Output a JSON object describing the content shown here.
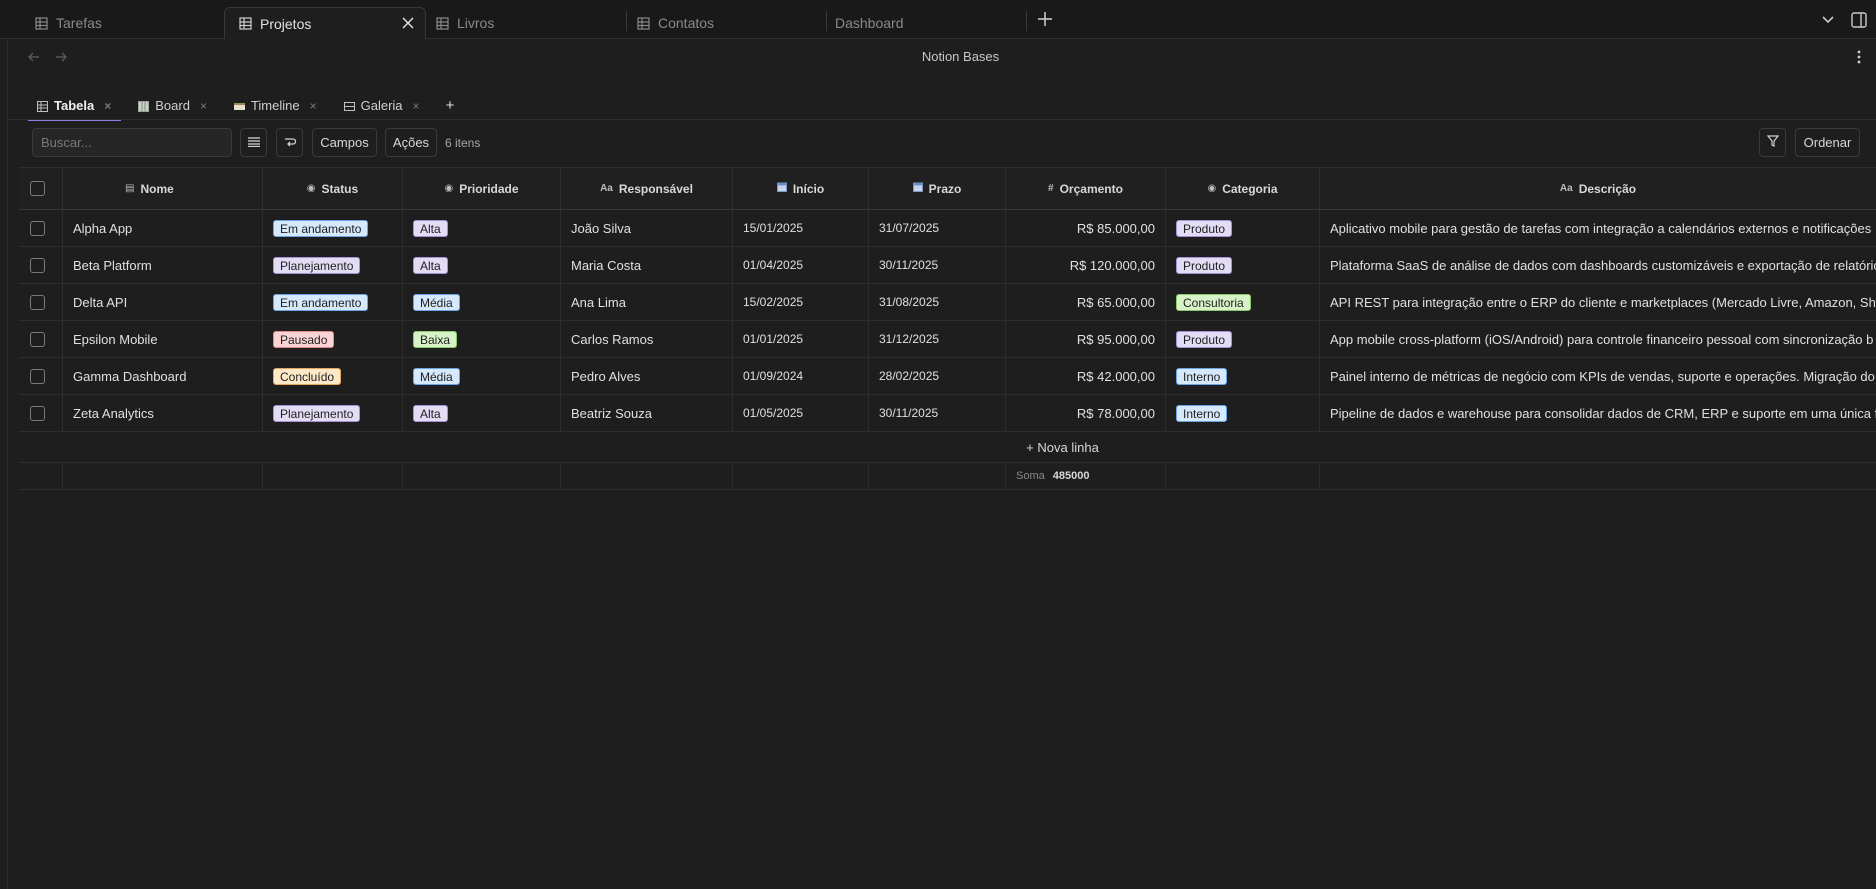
{
  "window_tabs": [
    {
      "label": "Tarefas",
      "active": false
    },
    {
      "label": "Projetos",
      "active": true
    },
    {
      "label": "Livros",
      "active": false
    },
    {
      "label": "Contatos",
      "active": false
    },
    {
      "label": "Dashboard",
      "active": false
    }
  ],
  "app_title": "Notion Bases",
  "view_tabs": [
    {
      "label": "Tabela",
      "icon": "table-icon",
      "active": true
    },
    {
      "label": "Board",
      "icon": "board-icon",
      "active": false
    },
    {
      "label": "Timeline",
      "icon": "timeline-icon",
      "active": false
    },
    {
      "label": "Galeria",
      "icon": "gallery-icon",
      "active": false
    }
  ],
  "toolbar": {
    "search_placeholder": "Buscar...",
    "fields_label": "Campos",
    "actions_label": "Ações",
    "count_label": "6 itens",
    "sort_label": "Ordenar"
  },
  "columns": [
    {
      "key": "nome",
      "label": "Nome",
      "icon": "page-icon"
    },
    {
      "key": "status",
      "label": "Status",
      "icon": "select-icon"
    },
    {
      "key": "prioridade",
      "label": "Prioridade",
      "icon": "select-icon"
    },
    {
      "key": "responsavel",
      "label": "Responsável",
      "icon": "text-icon"
    },
    {
      "key": "inicio",
      "label": "Início",
      "icon": "calendar-icon"
    },
    {
      "key": "prazo",
      "label": "Prazo",
      "icon": "calendar-icon"
    },
    {
      "key": "orcamento",
      "label": "Orçamento",
      "icon": "number-icon"
    },
    {
      "key": "categoria",
      "label": "Categoria",
      "icon": "select-icon"
    },
    {
      "key": "descricao",
      "label": "Descrição",
      "icon": "text-icon"
    }
  ],
  "rows": [
    {
      "nome": "Alpha App",
      "status": "Em andamento",
      "prioridade": "Alta",
      "responsavel": "João Silva",
      "inicio": "15/01/2025",
      "prazo": "31/07/2025",
      "orcamento": "R$ 85.000,00",
      "categoria": "Produto",
      "descricao": "Aplicativo mobile para gestão de tarefas com integração a calendários externos e notificações"
    },
    {
      "nome": "Beta Platform",
      "status": "Planejamento",
      "prioridade": "Alta",
      "responsavel": "Maria Costa",
      "inicio": "01/04/2025",
      "prazo": "30/11/2025",
      "orcamento": "R$ 120.000,00",
      "categoria": "Produto",
      "descricao": "Plataforma SaaS de análise de dados com dashboards customizáveis e exportação de relatórios"
    },
    {
      "nome": "Delta API",
      "status": "Em andamento",
      "prioridade": "Média",
      "responsavel": "Ana Lima",
      "inicio": "15/02/2025",
      "prazo": "31/08/2025",
      "orcamento": "R$ 65.000,00",
      "categoria": "Consultoria",
      "descricao": "API REST para integração entre o ERP do cliente e marketplaces (Mercado Livre, Amazon, Shop"
    },
    {
      "nome": "Epsilon Mobile",
      "status": "Pausado",
      "prioridade": "Baixa",
      "responsavel": "Carlos Ramos",
      "inicio": "01/01/2025",
      "prazo": "31/12/2025",
      "orcamento": "R$ 95.000,00",
      "categoria": "Produto",
      "descricao": "App mobile cross-platform (iOS/Android) para controle financeiro pessoal com sincronização b"
    },
    {
      "nome": "Gamma Dashboard",
      "status": "Concluído",
      "prioridade": "Média",
      "responsavel": "Pedro Alves",
      "inicio": "01/09/2024",
      "prazo": "28/02/2025",
      "orcamento": "R$ 42.000,00",
      "categoria": "Interno",
      "descricao": "Painel interno de métricas de negócio com KPIs de vendas, suporte e operações. Migração do"
    },
    {
      "nome": "Zeta Analytics",
      "status": "Planejamento",
      "prioridade": "Alta",
      "responsavel": "Beatriz Souza",
      "inicio": "01/05/2025",
      "prazo": "30/11/2025",
      "orcamento": "R$ 78.000,00",
      "categoria": "Interno",
      "descricao": "Pipeline de dados e warehouse para consolidar dados de CRM, ERP e suporte em uma única fo"
    }
  ],
  "new_row_label": "+ Nova linha",
  "footer": {
    "sum_label": "Soma",
    "sum_value": "485000"
  },
  "tag_colors": {
    "Em andamento": "blue",
    "Planejamento": "purple",
    "Pausado": "red",
    "Concluído": "orange",
    "Alta": "purple",
    "Média": "blue",
    "Baixa": "green",
    "Produto": "purple",
    "Consultoria": "green",
    "Interno": "blue"
  }
}
